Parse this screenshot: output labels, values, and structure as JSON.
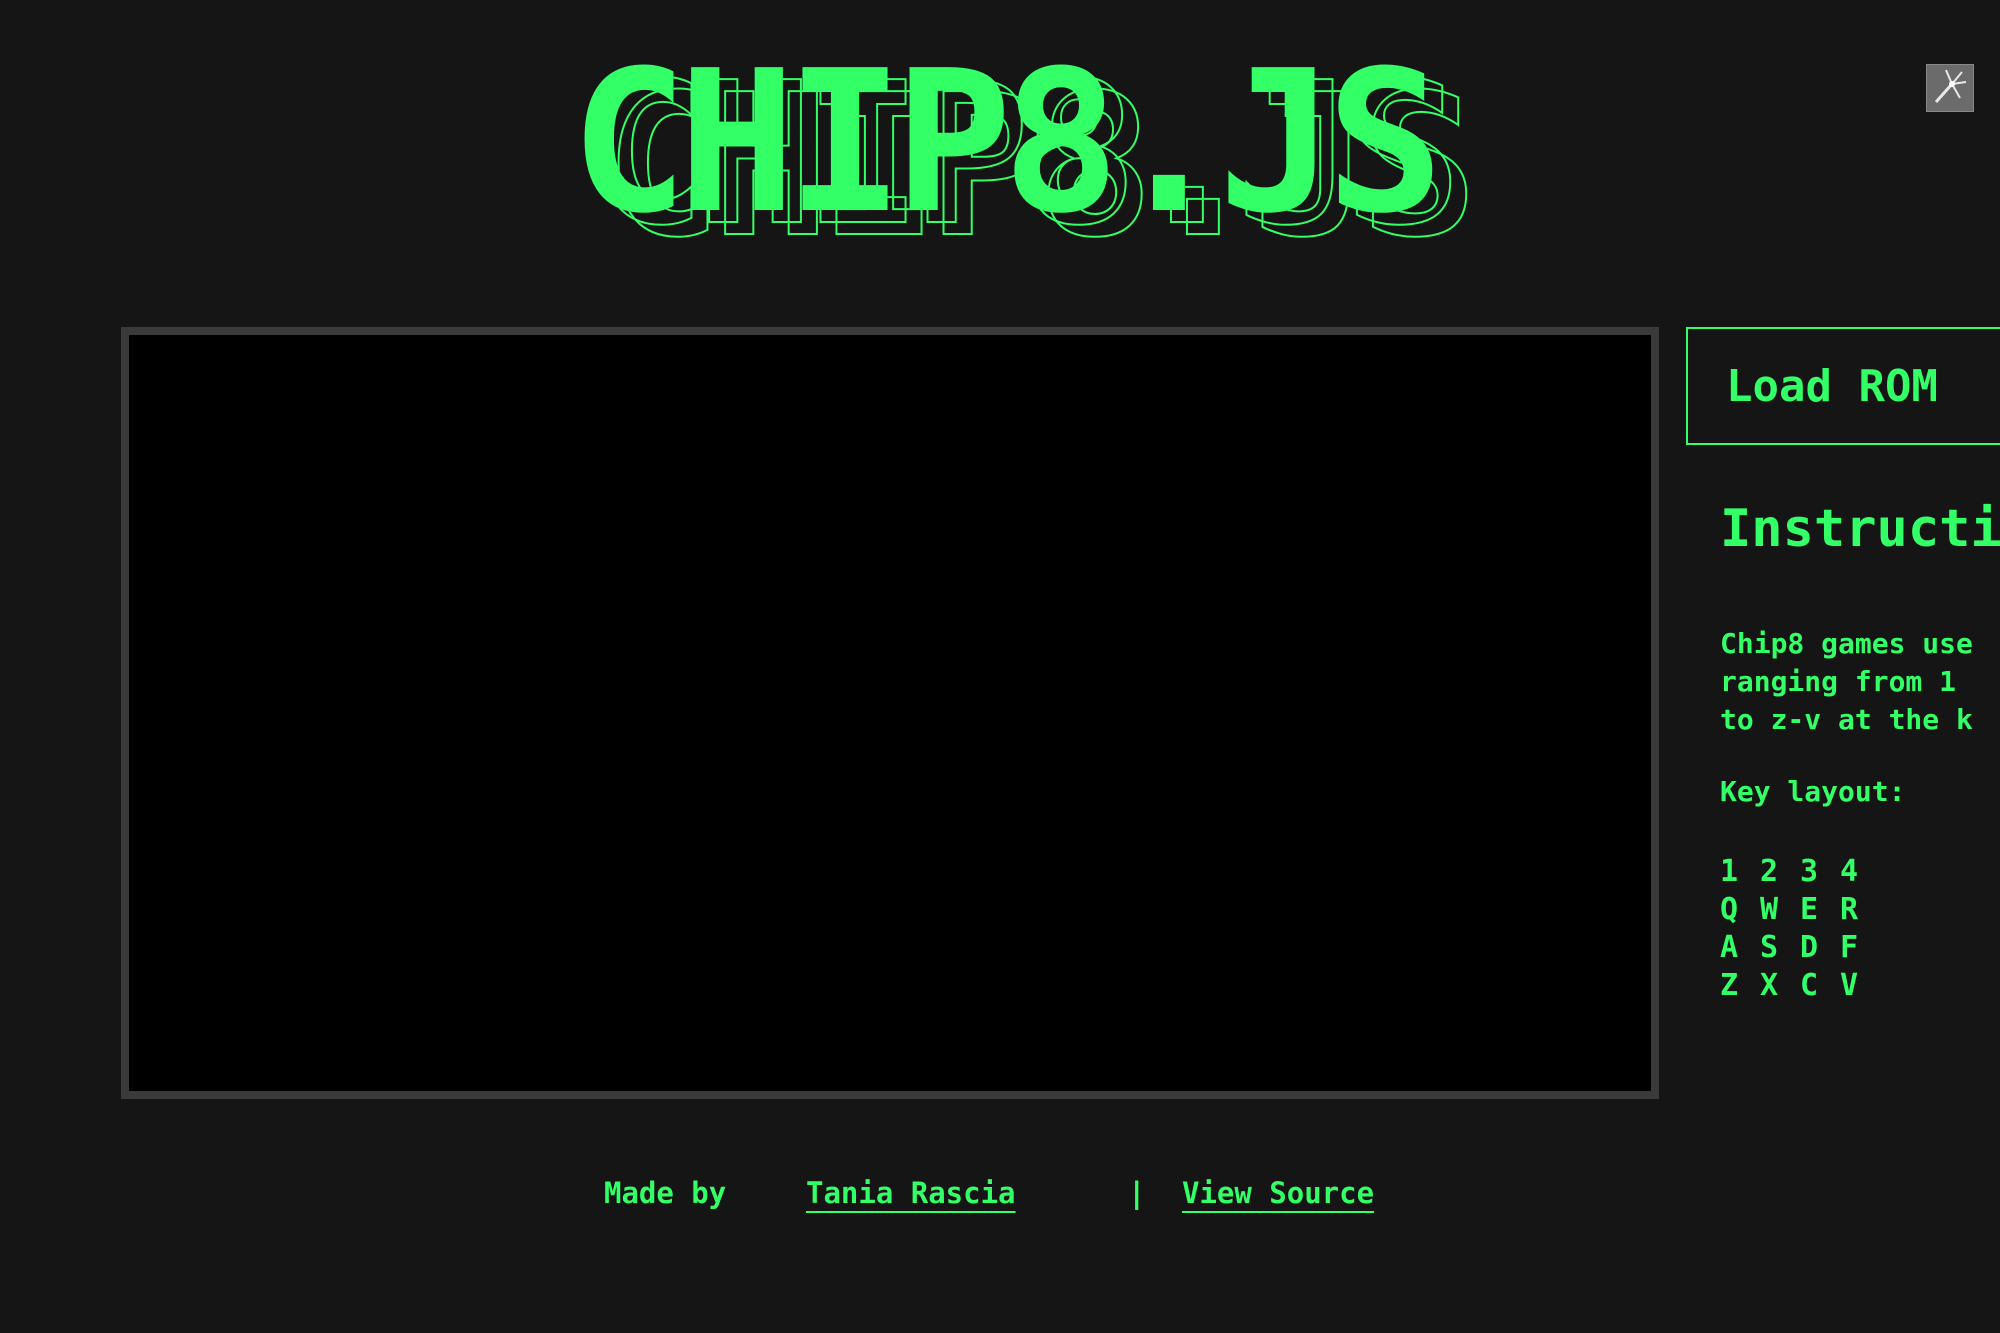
{
  "header": {
    "logo_text": "CHIP8.JS"
  },
  "corner_icon": {
    "icon": "wand-icon"
  },
  "sidebar": {
    "load_rom_label": "Load ROM",
    "instructions_title": "Instructions",
    "instructions_text": "Chip8 games use\nranging from 1\nto z-v at the k",
    "key_layout_label": "Key layout:",
    "keys": [
      [
        "1",
        "2",
        "3",
        "4"
      ],
      [
        "Q",
        "W",
        "E",
        "R"
      ],
      [
        "A",
        "S",
        "D",
        "F"
      ],
      [
        "Z",
        "X",
        "C",
        "V"
      ]
    ]
  },
  "footer": {
    "made_by": "Made by",
    "author": "Tania Rascia",
    "separator": "|",
    "view_source": "View Source"
  },
  "colors": {
    "accent": "#33ff66",
    "background": "#151515",
    "screen": "#000000",
    "screen_border": "#3a3a3a"
  }
}
